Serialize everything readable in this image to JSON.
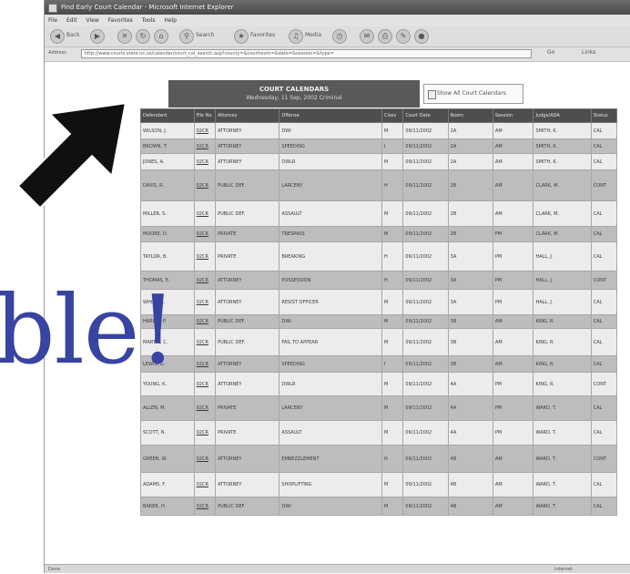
{
  "window": {
    "title": "Find Early Court Calendar - Microsoft Internet Explorer"
  },
  "menu": [
    "File",
    "Edit",
    "View",
    "Favorites",
    "Tools",
    "Help"
  ],
  "toolbar": {
    "back": "Back",
    "search": "Search",
    "favorites": "Favorites",
    "media": "Media"
  },
  "address": {
    "label": "Address",
    "url": "http://www.courts.state.nc.us/calendar/court_cal_search.asp?county=&courtroom=&date=&session=&type=",
    "go": "Go",
    "links": "Links"
  },
  "banner": {
    "title": "COURT CALENDARS",
    "subtitle": "Wednesday, 11 Sep, 2002 Criminal",
    "side_link": "Show All Court Calendars"
  },
  "table": {
    "headers": [
      "Defendant",
      "File No.",
      "Attorney",
      "Offense",
      "Class",
      "Court Date",
      "Room",
      "Session",
      "Judge/ADA",
      "Status"
    ],
    "rows": [
      [
        "WILSON, J.",
        "02CR",
        "ATTORNEY",
        "DWI",
        "M",
        "09/11/2002",
        "2A",
        "AM",
        "SMITH, K.",
        "CAL"
      ],
      [
        "BROWN, T.",
        "02CR",
        "ATTORNEY",
        "SPEEDING",
        "I",
        "09/11/2002",
        "2A",
        "AM",
        "SMITH, K.",
        "CAL"
      ],
      [
        "JONES, A.",
        "02CR",
        "ATTORNEY",
        "DWLR",
        "M",
        "09/11/2002",
        "2A",
        "AM",
        "SMITH, K.",
        "CAL"
      ],
      [
        "DAVIS, R.",
        "02CR",
        "PUBLIC DEF.",
        "LARCENY",
        "H",
        "09/11/2002",
        "2B",
        "AM",
        "CLARK, M.",
        "CONT"
      ],
      [
        "MILLER, S.",
        "02CR",
        "PUBLIC DEF.",
        "ASSAULT",
        "M",
        "09/11/2002",
        "2B",
        "AM",
        "CLARK, M.",
        "CAL"
      ],
      [
        "MOORE, D.",
        "02CR",
        "PRIVATE",
        "TRESPASS",
        "M",
        "09/11/2002",
        "2B",
        "PM",
        "CLARK, M.",
        "CAL"
      ],
      [
        "TAYLOR, B.",
        "02CR",
        "PRIVATE",
        "BREAKING",
        "H",
        "09/11/2002",
        "3A",
        "PM",
        "HALL, J.",
        "CAL"
      ],
      [
        "THOMAS, E.",
        "02CR",
        "ATTORNEY",
        "POSSESSION",
        "H",
        "09/11/2002",
        "3A",
        "PM",
        "HALL, J.",
        "CONT"
      ],
      [
        "WHITE, L.",
        "02CR",
        "ATTORNEY",
        "RESIST OFFICER",
        "M",
        "09/11/2002",
        "3A",
        "PM",
        "HALL, J.",
        "CAL"
      ],
      [
        "HARRIS, P.",
        "02CR",
        "PUBLIC DEF.",
        "DWI",
        "M",
        "09/11/2002",
        "3B",
        "AM",
        "KING, R.",
        "CAL"
      ],
      [
        "MARTIN, C.",
        "02CR",
        "PUBLIC DEF.",
        "FAIL TO APPEAR",
        "M",
        "09/11/2002",
        "3B",
        "AM",
        "KING, R.",
        "CAL"
      ],
      [
        "LEWIS, G.",
        "02CR",
        "ATTORNEY",
        "SPEEDING",
        "I",
        "09/11/2002",
        "3B",
        "AM",
        "KING, R.",
        "CAL"
      ],
      [
        "YOUNG, K.",
        "02CR",
        "ATTORNEY",
        "DWLR",
        "M",
        "09/11/2002",
        "4A",
        "PM",
        "KING, R.",
        "CONT"
      ],
      [
        "ALLEN, M.",
        "02CR",
        "PRIVATE",
        "LARCENY",
        "M",
        "09/11/2002",
        "4A",
        "PM",
        "WARD, T.",
        "CAL"
      ],
      [
        "SCOTT, N.",
        "02CR",
        "PRIVATE",
        "ASSAULT",
        "M",
        "09/11/2002",
        "4A",
        "PM",
        "WARD, T.",
        "CAL"
      ],
      [
        "GREEN, W.",
        "02CR",
        "ATTORNEY",
        "EMBEZZLEMENT",
        "H",
        "09/11/2002",
        "4B",
        "AM",
        "WARD, T.",
        "CONT"
      ],
      [
        "ADAMS, F.",
        "02CR",
        "ATTORNEY",
        "SHOPLIFTING",
        "M",
        "09/11/2002",
        "4B",
        "AM",
        "WARD, T.",
        "CAL"
      ],
      [
        "BAKER, H.",
        "02CR",
        "PUBLIC DEF.",
        "DWI",
        "M",
        "09/11/2002",
        "4B",
        "AM",
        "WARD, T.",
        "CAL"
      ]
    ]
  },
  "status": {
    "text": "Done",
    "zone": "Internet"
  },
  "overlay": {
    "text": "ble!"
  },
  "colors": {
    "overlay_text": "#3744a1",
    "header_bg": "#4e4e4e"
  }
}
